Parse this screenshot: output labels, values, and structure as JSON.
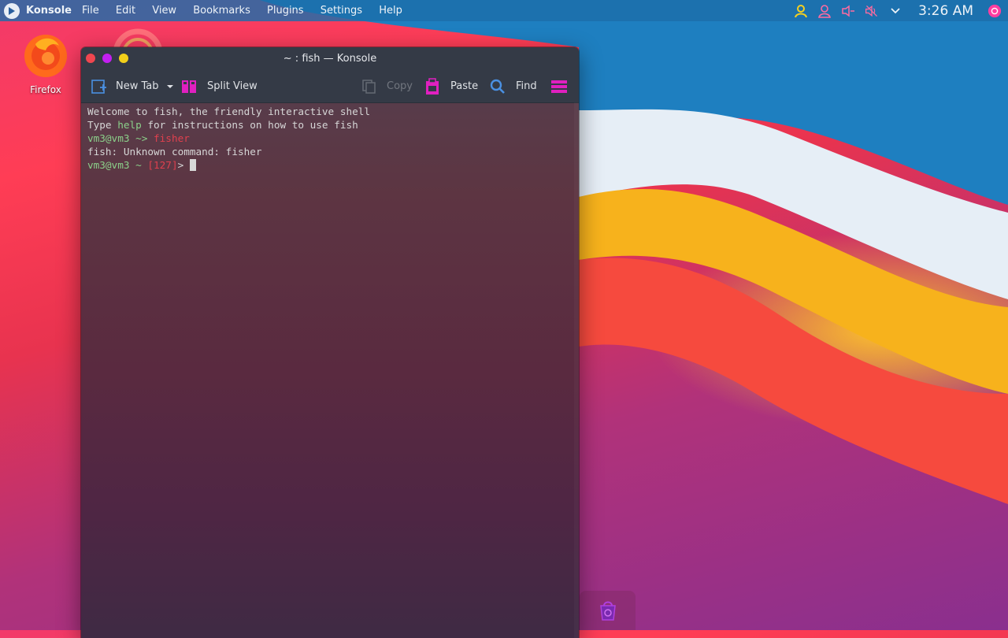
{
  "topbar": {
    "app_name": "Konsole",
    "menu": [
      "File",
      "Edit",
      "View",
      "Bookmarks",
      "Plugins",
      "Settings",
      "Help"
    ],
    "clock": "3:26 AM"
  },
  "desktop": {
    "icons": [
      {
        "label": "Firefox",
        "icon": "firefox-icon"
      }
    ]
  },
  "window": {
    "title": "~ : fish — Konsole",
    "toolbar": {
      "new_tab": "New Tab",
      "split_view": "Split View",
      "copy": "Copy",
      "paste": "Paste",
      "find": "Find"
    }
  },
  "terminal": {
    "line1": "Welcome to fish, the friendly interactive shell",
    "line2_pre": "Type ",
    "line2_cmd": "help",
    "line2_post": " for instructions on how to use fish",
    "line3_prompt": "vm3@vm3 ~> ",
    "line3_cmd": "fisher",
    "line4": "fish: Unknown command: fisher",
    "line5_prompt": "vm3@vm3 ~ ",
    "line5_status": "[127]",
    "line5_end": "> "
  },
  "colors": {
    "panel": "#1c6eaa",
    "accent": "#e020c0",
    "toolbar_icon": "#4a90e2",
    "prompt_green": "#8bd08a",
    "error_red": "#e0404e"
  }
}
